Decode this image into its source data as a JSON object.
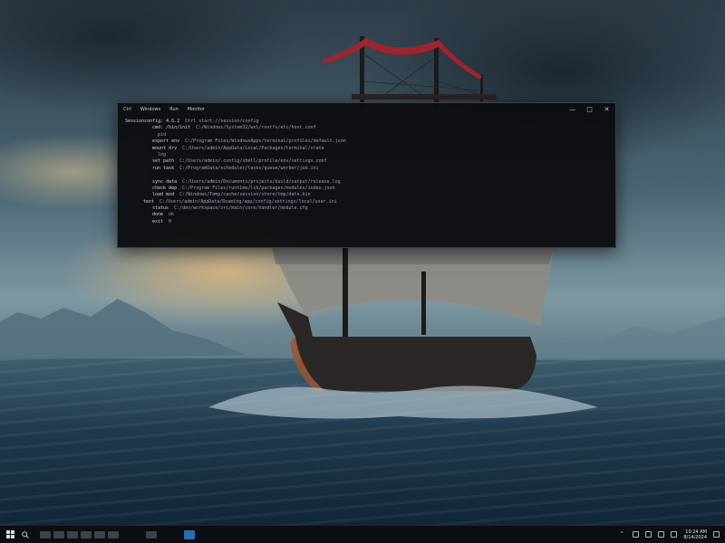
{
  "terminal": {
    "tabs": [
      "Ctrl",
      "Windows",
      "Run",
      "Monitor"
    ],
    "controls": [
      "—",
      "□",
      "✕"
    ],
    "lines": [
      {
        "indent": 0,
        "a": "Sessionconfig: 4.6.2",
        "b": "Ctrl start://session/config"
      },
      {
        "indent": 3,
        "a": "cmd: /bin/init",
        "b": "C:/Windows/System32/wsl/rootfs/etc/host.conf"
      },
      {
        "indent": 3,
        "a": "",
        "b": "pid"
      },
      {
        "indent": 3,
        "a": "export env",
        "b": "C:/Program Files/WindowsApps/terminal/profiles/default.json"
      },
      {
        "indent": 3,
        "a": "mount drv",
        "b": "C:/Users/admin/AppData/Local/Packages/terminal/state"
      },
      {
        "indent": 3,
        "a": "",
        "b": "log"
      },
      {
        "indent": 3,
        "a": "set path",
        "b": "C:/Users/admin/.config/shell/profile/env/settings.conf"
      },
      {
        "indent": 3,
        "a": "run task",
        "b": "C:/ProgramData/scheduler/tasks/queue/worker/job.ini"
      },
      {
        "indent": 2,
        "a": "",
        "b": ""
      },
      {
        "indent": 3,
        "a": "sync data",
        "b": "C:/Users/admin/Documents/projects/build/output/release.log"
      },
      {
        "indent": 3,
        "a": "check dep",
        "b": "C:/Program Files/runtime/lib/packages/modules/index.json"
      },
      {
        "indent": 3,
        "a": "load mod",
        "b": "C:/Windows/Temp/cache/session/store/tmp/data.bin"
      },
      {
        "indent": 2,
        "a": "test",
        "b": "C:/Users/admin/AppData/Roaming/app/config/settings/local/user.ini"
      },
      {
        "indent": 3,
        "a": "status",
        "b": "C:/dev/workspace/src/main/core/handler/module.cfg"
      },
      {
        "indent": 3,
        "a": "done",
        "b": "ok"
      },
      {
        "indent": 3,
        "a": "exit",
        "b": "0"
      }
    ]
  },
  "taskbar": {
    "start_icon": "windows-logo-icon",
    "tray_icons": [
      "chevron-up-icon",
      "network-icon",
      "volume-icon",
      "battery-icon",
      "language-icon",
      "notification-icon"
    ],
    "clock_time": "10:24 AM",
    "clock_date": "8/14/2024"
  }
}
